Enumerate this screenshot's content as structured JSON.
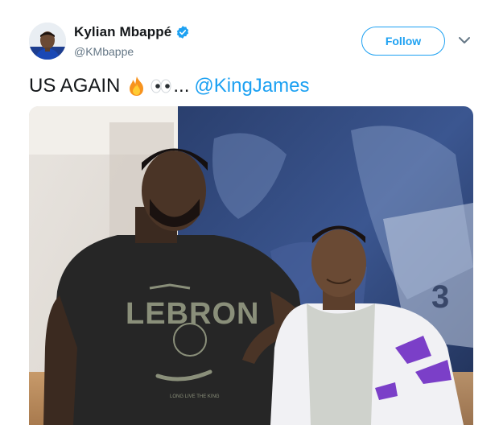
{
  "author": {
    "display_name": "Kylian Mbappé",
    "handle": "@KMbappe",
    "verified": true
  },
  "follow_button": {
    "label": "Follow"
  },
  "tweet": {
    "text_before": "US AGAIN",
    "emojis": [
      "fire",
      "eyes"
    ],
    "ellipsis": "...",
    "mention": "@KingJames"
  },
  "media": {
    "shirt_text": "LEBRON",
    "shirt_small_text": "LONG LIVE THE KING"
  },
  "colors": {
    "accent": "#1da1f2",
    "text": "#14171a",
    "secondary": "#657786"
  }
}
